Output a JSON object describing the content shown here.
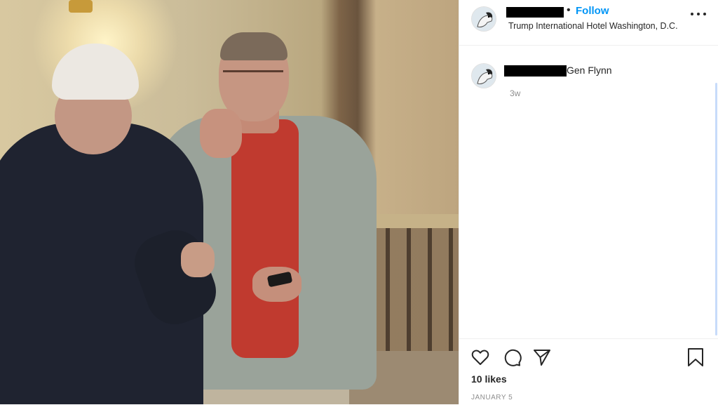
{
  "post": {
    "username_redacted": true,
    "separator": "•",
    "follow_label": "Follow",
    "location": "Trump International Hotel Washington, D.C.",
    "more_icon": "more-options-icon"
  },
  "comment": {
    "text": "Gen Flynn",
    "time_ago": "3w"
  },
  "actions": {
    "icons": [
      "heart-icon",
      "comment-icon",
      "share-icon",
      "bookmark-icon"
    ],
    "likes": "10 likes",
    "date": "JANUARY 5"
  },
  "colors": {
    "follow": "#0095f6",
    "text": "#262626",
    "muted": "#8e8e8e"
  }
}
